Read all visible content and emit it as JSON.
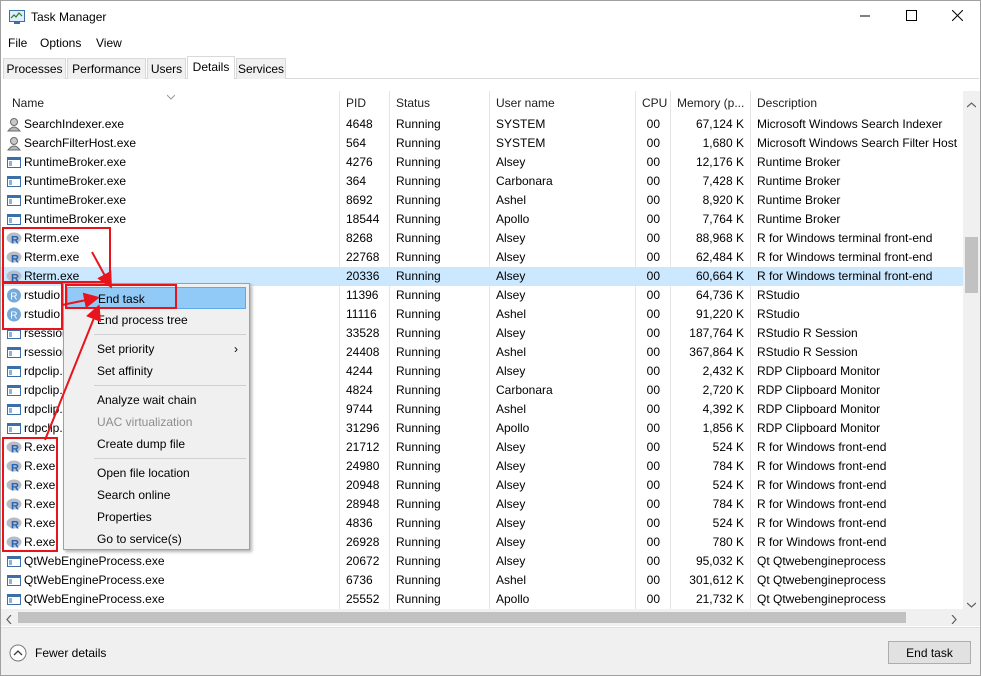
{
  "window": {
    "title": "Task Manager",
    "app_icon": "task-manager-icon",
    "controls": {
      "minimize": "minimize-icon",
      "maximize": "maximize-icon",
      "close": "close-icon"
    }
  },
  "menu": [
    "File",
    "Options",
    "View"
  ],
  "tabs": [
    {
      "label": "Processes"
    },
    {
      "label": "Performance"
    },
    {
      "label": "Users"
    },
    {
      "label": "Details",
      "active": true
    },
    {
      "label": "Services"
    }
  ],
  "columns": {
    "name": "Name",
    "pid": "PID",
    "status": "Status",
    "user": "User name",
    "cpu": "CPU",
    "memory": "Memory (p...",
    "description": "Description"
  },
  "rows": [
    {
      "icon": "search-indexer-icon",
      "name": "SearchIndexer.exe",
      "pid": "4648",
      "status": "Running",
      "user": "SYSTEM",
      "cpu": "00",
      "memory": "67,124 K",
      "description": "Microsoft Windows Search Indexer"
    },
    {
      "icon": "search-indexer-icon",
      "name": "SearchFilterHost.exe",
      "pid": "564",
      "status": "Running",
      "user": "SYSTEM",
      "cpu": "00",
      "memory": "1,680 K",
      "description": "Microsoft Windows Search Filter Host"
    },
    {
      "icon": "window-process-icon",
      "name": "RuntimeBroker.exe",
      "pid": "4276",
      "status": "Running",
      "user": "Alsey",
      "cpu": "00",
      "memory": "12,176 K",
      "description": "Runtime Broker"
    },
    {
      "icon": "window-process-icon",
      "name": "RuntimeBroker.exe",
      "pid": "364",
      "status": "Running",
      "user": "Carbonara",
      "cpu": "00",
      "memory": "7,428 K",
      "description": "Runtime Broker"
    },
    {
      "icon": "window-process-icon",
      "name": "RuntimeBroker.exe",
      "pid": "8692",
      "status": "Running",
      "user": "Ashel",
      "cpu": "00",
      "memory": "8,920 K",
      "description": "Runtime Broker"
    },
    {
      "icon": "window-process-icon",
      "name": "RuntimeBroker.exe",
      "pid": "18544",
      "status": "Running",
      "user": "Apollo",
      "cpu": "00",
      "memory": "7,764 K",
      "description": "Runtime Broker"
    },
    {
      "icon": "r-logo-icon",
      "name": "Rterm.exe",
      "pid": "8268",
      "status": "Running",
      "user": "Alsey",
      "cpu": "00",
      "memory": "88,968 K",
      "description": "R for Windows terminal front-end"
    },
    {
      "icon": "r-logo-icon",
      "name": "Rterm.exe",
      "pid": "22768",
      "status": "Running",
      "user": "Alsey",
      "cpu": "00",
      "memory": "62,484 K",
      "description": "R for Windows terminal front-end"
    },
    {
      "icon": "r-logo-icon",
      "name": "Rterm.exe",
      "pid": "20336",
      "status": "Running",
      "user": "Alsey",
      "cpu": "00",
      "memory": "60,664 K",
      "description": "R for Windows terminal front-end",
      "selected": true
    },
    {
      "icon": "rstudio-icon",
      "name": "rstudio.exe",
      "pid": "11396",
      "status": "Running",
      "user": "Alsey",
      "cpu": "00",
      "memory": "64,736 K",
      "description": "RStudio"
    },
    {
      "icon": "rstudio-icon",
      "name": "rstudio.exe",
      "pid": "11116",
      "status": "Running",
      "user": "Ashel",
      "cpu": "00",
      "memory": "91,220 K",
      "description": "RStudio"
    },
    {
      "icon": "window-process-icon",
      "name": "rsession.exe",
      "pid": "33528",
      "status": "Running",
      "user": "Alsey",
      "cpu": "00",
      "memory": "187,764 K",
      "description": "RStudio R Session"
    },
    {
      "icon": "window-process-icon",
      "name": "rsession.exe",
      "pid": "24408",
      "status": "Running",
      "user": "Ashel",
      "cpu": "00",
      "memory": "367,864 K",
      "description": "RStudio R Session"
    },
    {
      "icon": "window-process-icon",
      "name": "rdpclip.exe",
      "pid": "4244",
      "status": "Running",
      "user": "Alsey",
      "cpu": "00",
      "memory": "2,432 K",
      "description": "RDP Clipboard Monitor"
    },
    {
      "icon": "window-process-icon",
      "name": "rdpclip.exe",
      "pid": "4824",
      "status": "Running",
      "user": "Carbonara",
      "cpu": "00",
      "memory": "2,720 K",
      "description": "RDP Clipboard Monitor"
    },
    {
      "icon": "window-process-icon",
      "name": "rdpclip.exe",
      "pid": "9744",
      "status": "Running",
      "user": "Ashel",
      "cpu": "00",
      "memory": "4,392 K",
      "description": "RDP Clipboard Monitor"
    },
    {
      "icon": "window-process-icon",
      "name": "rdpclip.exe",
      "pid": "31296",
      "status": "Running",
      "user": "Apollo",
      "cpu": "00",
      "memory": "1,856 K",
      "description": "RDP Clipboard Monitor"
    },
    {
      "icon": "r-logo-icon",
      "name": "R.exe",
      "pid": "21712",
      "status": "Running",
      "user": "Alsey",
      "cpu": "00",
      "memory": "524 K",
      "description": "R for Windows front-end"
    },
    {
      "icon": "r-logo-icon",
      "name": "R.exe",
      "pid": "24980",
      "status": "Running",
      "user": "Alsey",
      "cpu": "00",
      "memory": "784 K",
      "description": "R for Windows front-end"
    },
    {
      "icon": "r-logo-icon",
      "name": "R.exe",
      "pid": "20948",
      "status": "Running",
      "user": "Alsey",
      "cpu": "00",
      "memory": "524 K",
      "description": "R for Windows front-end"
    },
    {
      "icon": "r-logo-icon",
      "name": "R.exe",
      "pid": "28948",
      "status": "Running",
      "user": "Alsey",
      "cpu": "00",
      "memory": "784 K",
      "description": "R for Windows front-end"
    },
    {
      "icon": "r-logo-icon",
      "name": "R.exe",
      "pid": "4836",
      "status": "Running",
      "user": "Alsey",
      "cpu": "00",
      "memory": "524 K",
      "description": "R for Windows front-end"
    },
    {
      "icon": "r-logo-icon",
      "name": "R.exe",
      "pid": "26928",
      "status": "Running",
      "user": "Alsey",
      "cpu": "00",
      "memory": "780 K",
      "description": "R for Windows front-end"
    },
    {
      "icon": "window-process-icon",
      "name": "QtWebEngineProcess.exe",
      "pid": "20672",
      "status": "Running",
      "user": "Alsey",
      "cpu": "00",
      "memory": "95,032 K",
      "description": "Qt Qtwebengineprocess"
    },
    {
      "icon": "window-process-icon",
      "name": "QtWebEngineProcess.exe",
      "pid": "6736",
      "status": "Running",
      "user": "Ashel",
      "cpu": "00",
      "memory": "301,612 K",
      "description": "Qt Qtwebengineprocess"
    },
    {
      "icon": "window-process-icon",
      "name": "QtWebEngineProcess.exe",
      "pid": "25552",
      "status": "Running",
      "user": "Apollo",
      "cpu": "00",
      "memory": "21,732 K",
      "description": "Qt Qtwebengineprocess"
    }
  ],
  "context_menu": {
    "end_task": "End task",
    "end_process_tree": "End process tree",
    "set_priority": "Set priority",
    "set_affinity": "Set affinity",
    "analyze_wait_chain": "Analyze wait chain",
    "uac_virtualization": "UAC virtualization",
    "create_dump_file": "Create dump file",
    "open_file_location": "Open file location",
    "search_online": "Search online",
    "properties": "Properties",
    "go_to_services": "Go to service(s)"
  },
  "footer": {
    "fewer_details": "Fewer details",
    "end_task": "End task"
  },
  "colors": {
    "selected_row": "#cce8ff",
    "menu_highlight": "#91c9f7",
    "annotation_red": "#e8141c"
  }
}
